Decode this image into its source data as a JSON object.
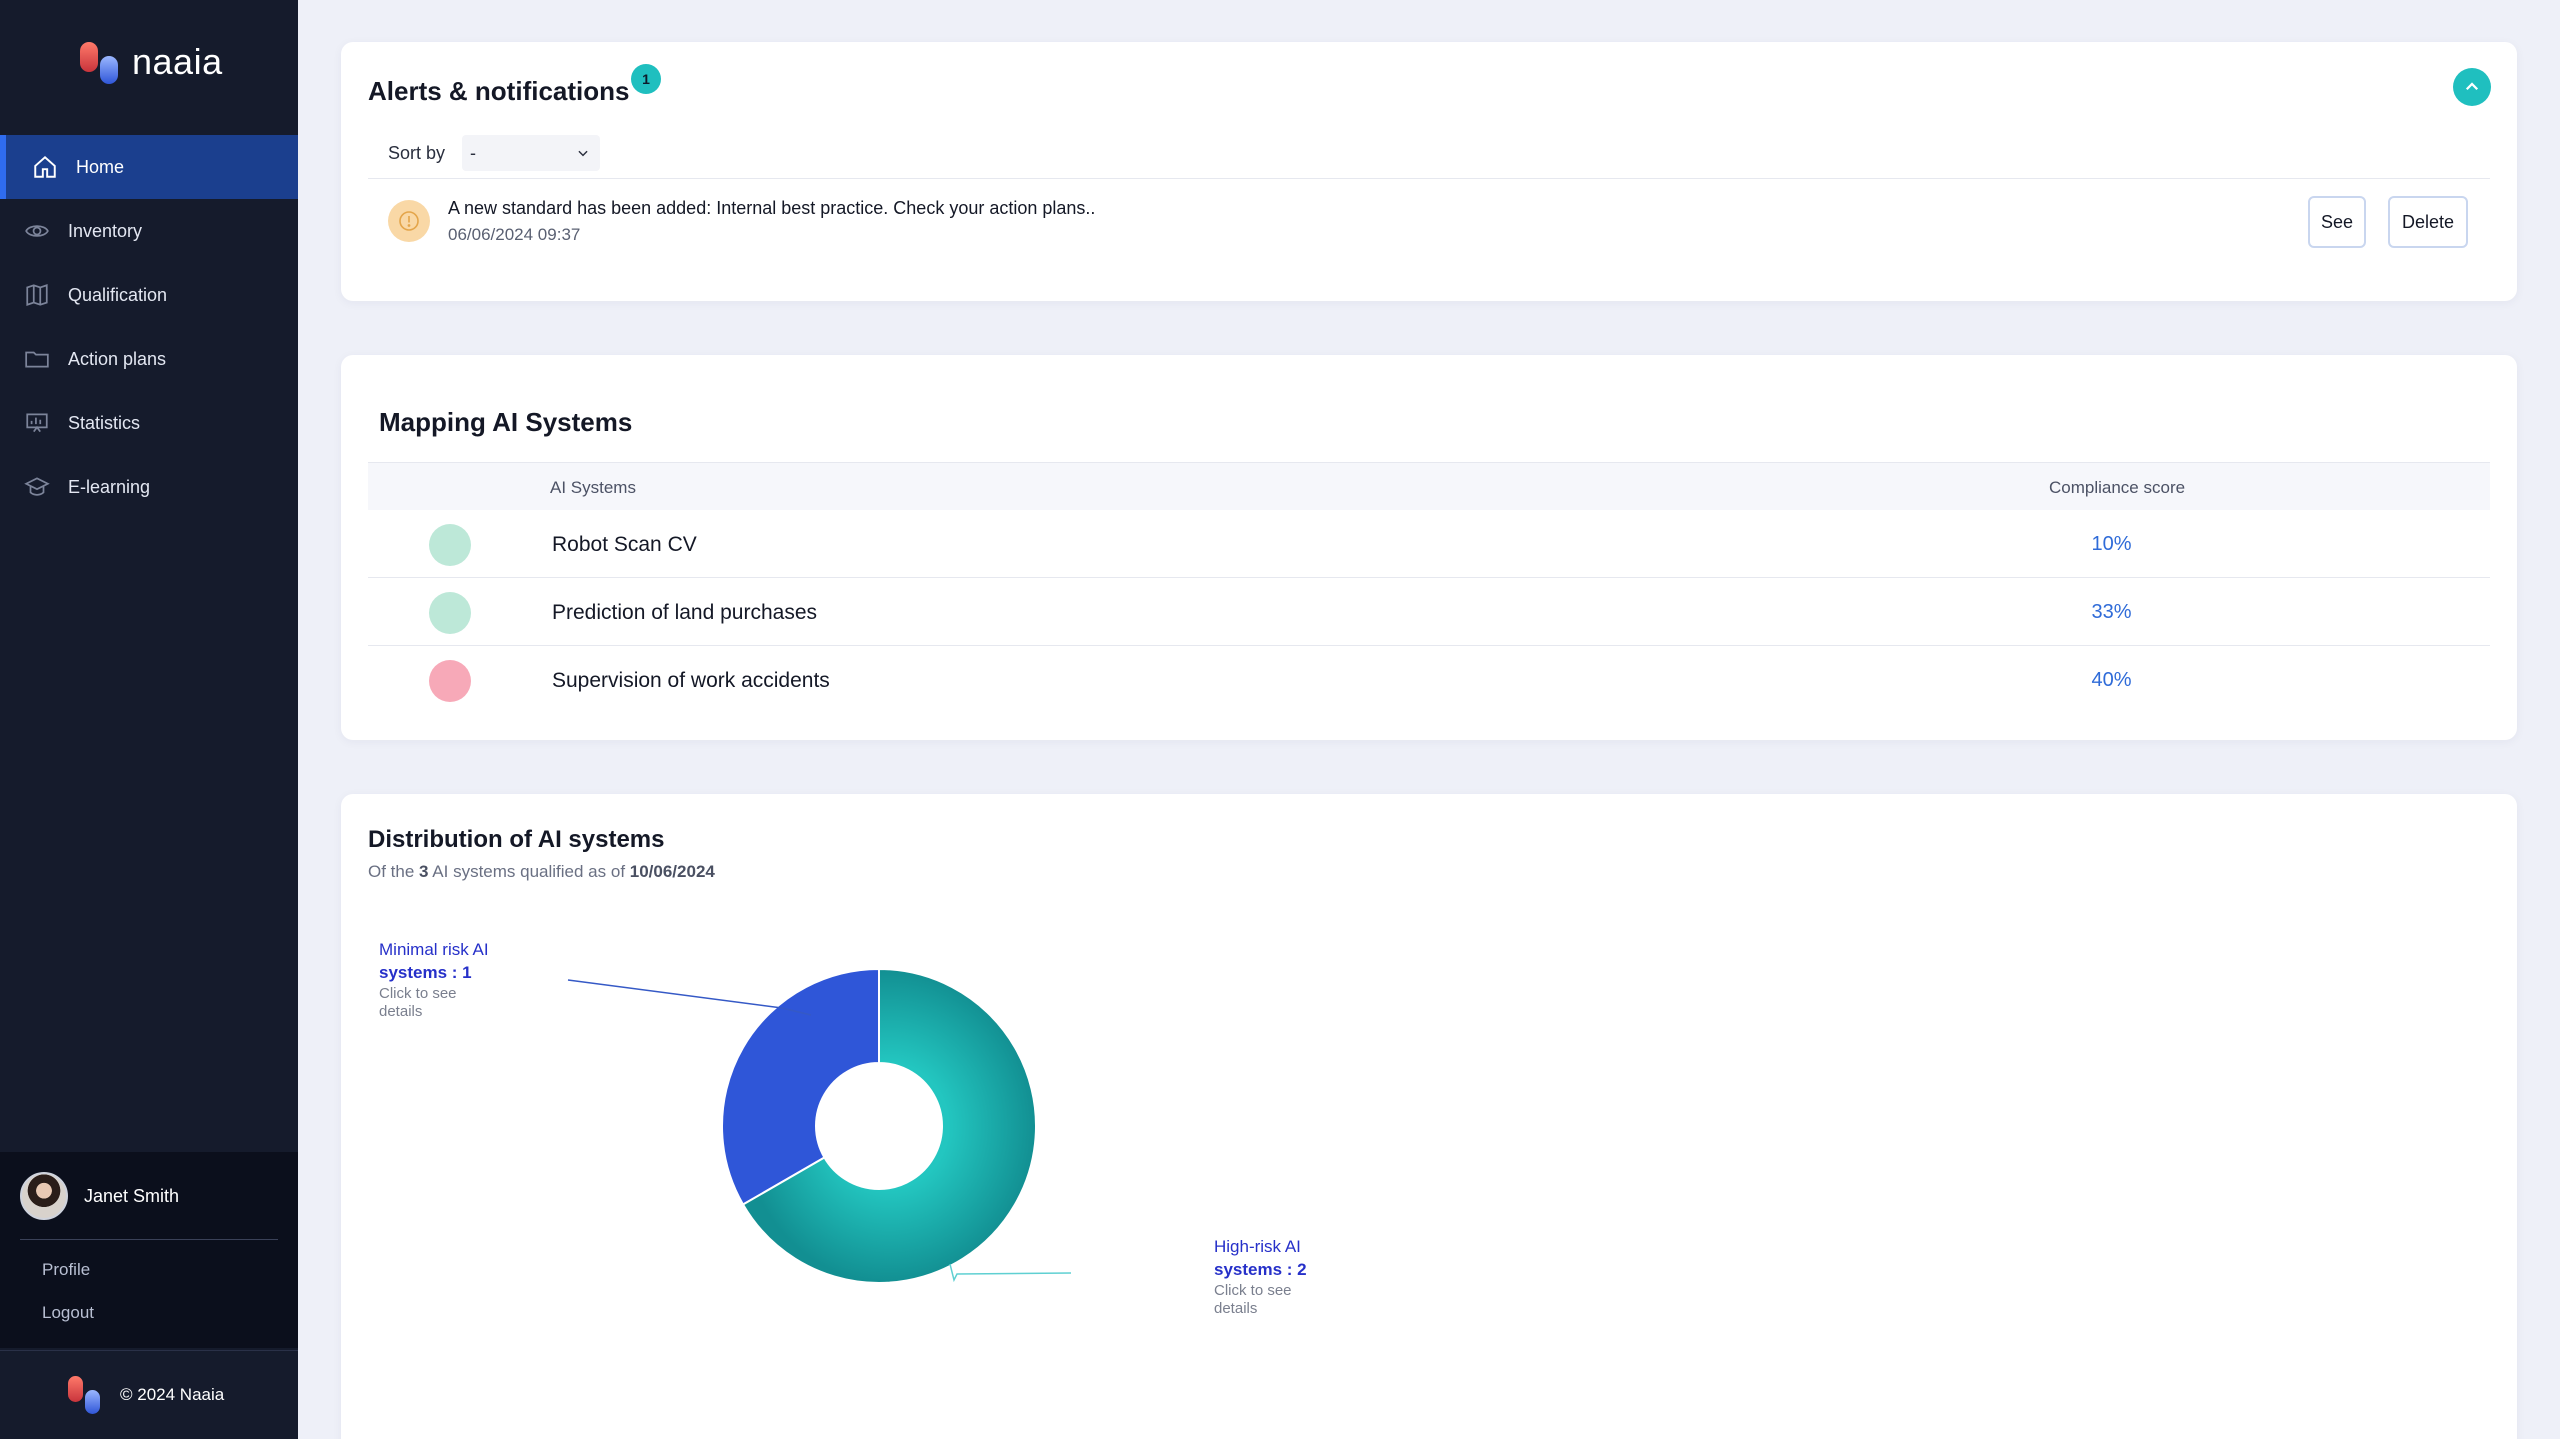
{
  "app": {
    "name": "naaia"
  },
  "sidebar": {
    "items": [
      {
        "label": "Home",
        "icon": "home-icon",
        "active": true
      },
      {
        "label": "Inventory",
        "icon": "eye-icon",
        "active": false
      },
      {
        "label": "Qualification",
        "icon": "map-icon",
        "active": false
      },
      {
        "label": "Action plans",
        "icon": "folder-icon",
        "active": false
      },
      {
        "label": "Statistics",
        "icon": "chart-icon",
        "active": false
      },
      {
        "label": "E-learning",
        "icon": "graduation-cap-icon",
        "active": false
      }
    ],
    "user": {
      "name": "Janet Smith",
      "profile": "Profile",
      "logout": "Logout"
    },
    "footer": "© 2024 Naaia"
  },
  "alerts": {
    "title": "Alerts & notifications",
    "count": "1",
    "sort_label": "Sort by",
    "sort_value": "-",
    "items": [
      {
        "message": "A new standard has been added: Internal best practice. Check your action plans..",
        "date": "06/06/2024 09:37",
        "see": "See",
        "delete": "Delete"
      }
    ]
  },
  "mapping": {
    "title": "Mapping AI Systems",
    "columns": [
      "AI Systems",
      "Compliance score"
    ],
    "rows": [
      {
        "name": "Robot Scan CV",
        "score": "10%",
        "color": "#bde8d8"
      },
      {
        "name": "Prediction of land purchases",
        "score": "33%",
        "color": "#bde8d8"
      },
      {
        "name": "Supervision of work accidents",
        "score": "40%",
        "color": "#f7a9b8"
      }
    ]
  },
  "distribution": {
    "title": "Distribution of AI systems",
    "subtitle_pre": "Of the ",
    "subtitle_count": "3",
    "subtitle_mid": " AI systems qualified as of ",
    "subtitle_date": "10/06/2024"
  },
  "chart_data": {
    "type": "pie",
    "variant": "donut",
    "categories": [
      "Minimal risk AI systems",
      "High-risk AI systems"
    ],
    "values": [
      1,
      2
    ],
    "colors": [
      "#2f56d8",
      "#1fbfbf"
    ],
    "labels": [
      {
        "line1": "Minimal risk AI",
        "line2": "systems : 1",
        "hint1": "Click to see",
        "hint2": "details"
      },
      {
        "line1": "High-risk AI",
        "line2": "systems : 2",
        "hint1": "Click to see",
        "hint2": "details"
      }
    ]
  }
}
